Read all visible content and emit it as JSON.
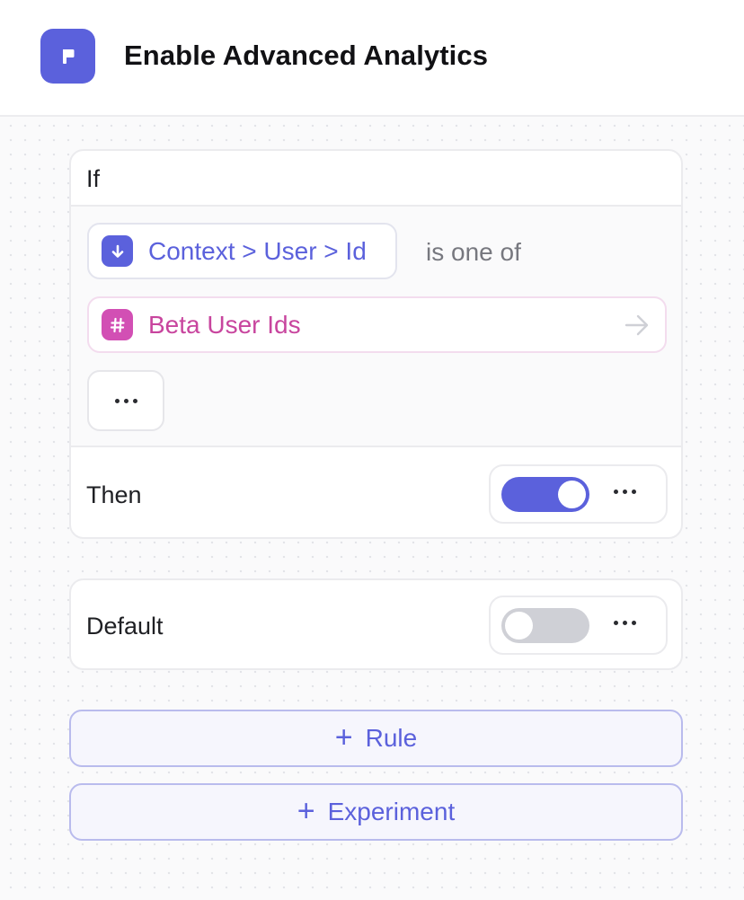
{
  "header": {
    "title": "Enable Advanced Analytics",
    "icon": "flag-icon",
    "accent": "#5b61dc"
  },
  "rule": {
    "if_label": "If",
    "condition": {
      "context_path": "Context > User > Id",
      "context_icon": "arrow-down-circle-icon",
      "operator": "is one of",
      "segment": "Beta User Ids",
      "segment_icon": "hash-icon",
      "segment_color": "#c8459e"
    },
    "then_label": "Then",
    "then_toggle_on": true
  },
  "default": {
    "label": "Default",
    "toggle_on": false
  },
  "actions": {
    "add_rule_label": "Rule",
    "add_experiment_label": "Experiment"
  }
}
